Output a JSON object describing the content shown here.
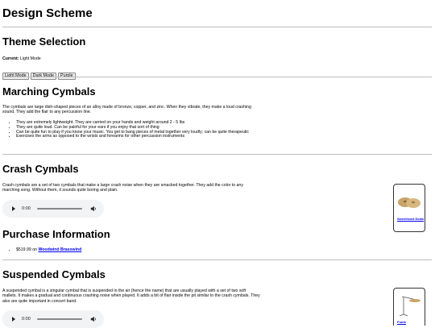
{
  "title": "Design Scheme",
  "theme": {
    "heading": "Theme Selection",
    "current_label": "Current:",
    "current_value": "Light Mode",
    "buttons": [
      "Light Mode",
      "Dark Mode",
      "Purple"
    ]
  },
  "marching": {
    "heading": "Marching Cymbals",
    "description": "The cymbals are large dish-shaped pieces of an alloy made of bronze, copper, and zinc. When they vibrate, they make a loud crashing sound. They add the flair to any percussion line.",
    "bullets": [
      "They are extremely lightweight. They are carried on your hands and weight around 2 - 5 lbs",
      "They are quite loud. Can be painful for your ears if you enjoy that sort of thing",
      "Can be quite fun to play if you know your music. You get to bang pieces of metal together very loudly; can be quite therapeutic",
      "Exercises the arms as opposed to the wrists and forearms for other percussion instruments"
    ]
  },
  "crash": {
    "heading": "Crash Cymbals",
    "description": "Crash cymbals are a set of two cymbals that make a large crash noise when they are smacked together. They add the color to any marching song. Without them, it sounds quite boring and plain.",
    "audio_time": "0:00",
    "card_link": "Sweetheart Deals"
  },
  "purchase": {
    "heading": "Purchase Information",
    "price": "$519.99",
    "on": "on",
    "store": "Woodwind Brasswind"
  },
  "suspended": {
    "heading": "Suspended Cymbals",
    "description": "A suspended cymbal is a singular cymbal that is suspended in the air (hence the name) that are usually played with a set of two soft mallets. It makes a gradual and continuous crashing noise when played. It adds a bit of flair inside the pit similar to the crash cymbals. They also are quite important in concert band.",
    "audio_time": "0:00",
    "card_link": "Frank"
  },
  "colors": {
    "link": "#0000ee",
    "player_bg": "#f1f3f4",
    "divider": "#bdbdbd"
  }
}
